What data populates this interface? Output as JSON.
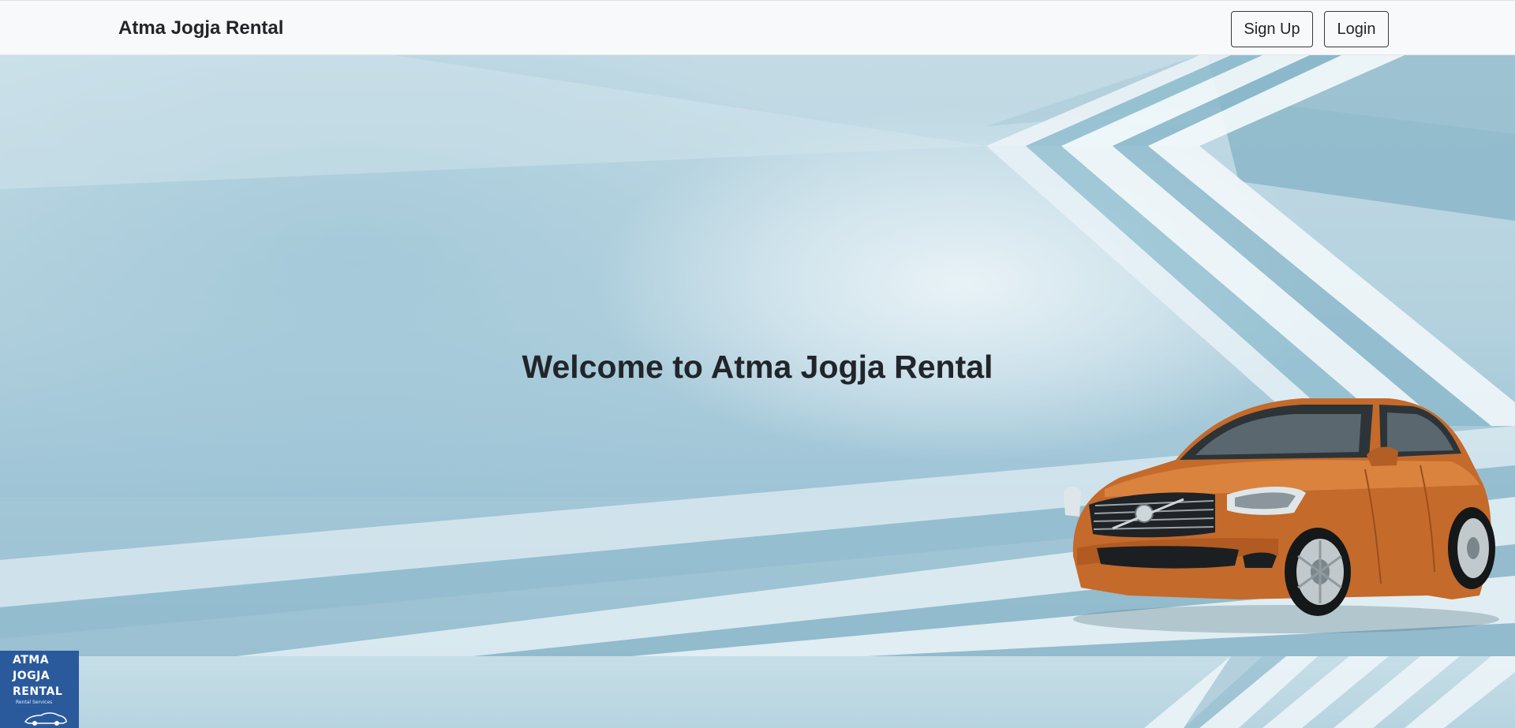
{
  "navbar": {
    "brand": "Atma Jogja Rental",
    "signup_label": "Sign Up",
    "login_label": "Login"
  },
  "hero": {
    "heading": "Welcome to Atma Jogja Rental"
  },
  "logo": {
    "line1": "ATMA",
    "line2": "JOGJA",
    "line3": "RENTAL",
    "subtitle": "Rental Services"
  },
  "colors": {
    "navbar_bg": "#f8f9fa",
    "text": "#212529",
    "car_orange": "#c56a2a",
    "logo_bg": "#2a5a9c",
    "hero_bg": "#b3d1de"
  },
  "icons": {
    "car_image": "car-image",
    "logo": "logo-icon"
  }
}
